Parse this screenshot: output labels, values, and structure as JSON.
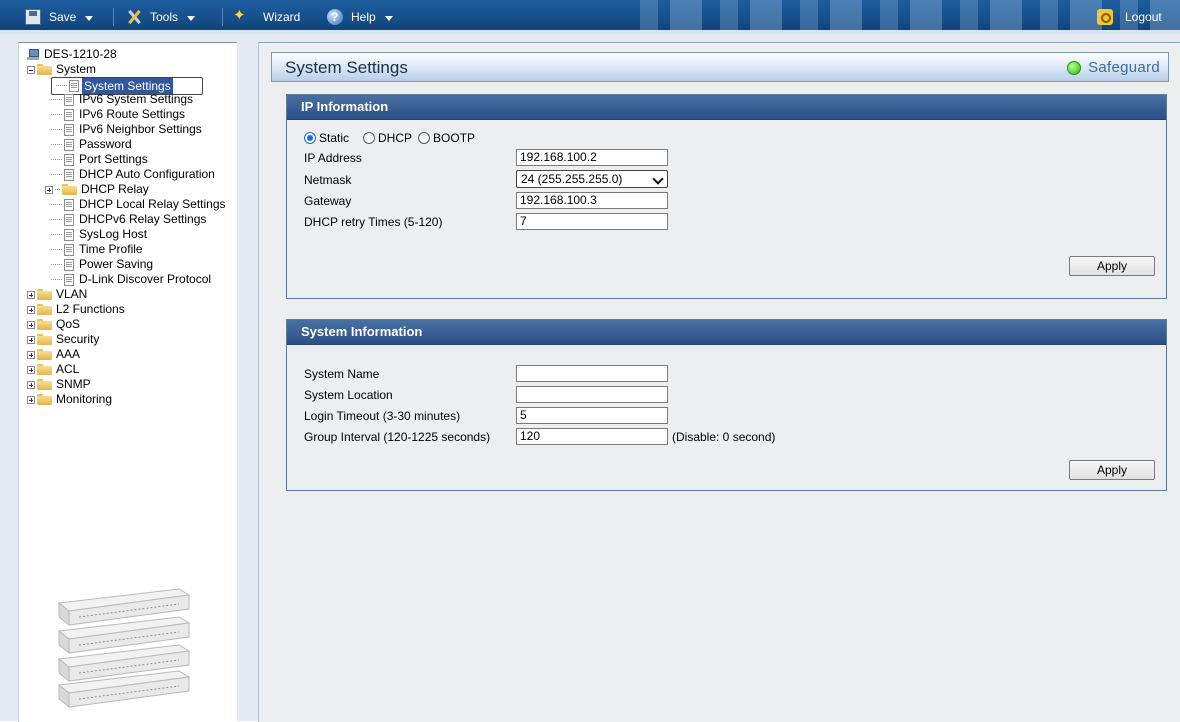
{
  "toolbar": {
    "save": "Save",
    "tools": "Tools",
    "wizard": "Wizard",
    "help": "Help",
    "logout": "Logout"
  },
  "tree": {
    "root": "DES-1210-28",
    "system": "System",
    "children": [
      "System Settings",
      "IPv6 System Settings",
      "IPv6 Route Settings",
      "IPv6 Neighbor Settings",
      "Password",
      "Port Settings",
      "DHCP Auto Configuration",
      "DHCP Relay",
      "DHCP Local Relay Settings",
      "DHCPv6 Relay Settings",
      "SysLog Host",
      "Time Profile",
      "Power Saving",
      "D-Link Discover Protocol"
    ],
    "groups": [
      "VLAN",
      "L2 Functions",
      "QoS",
      "Security",
      "AAA",
      "ACL",
      "SNMP",
      "Monitoring"
    ],
    "selected": "System Settings"
  },
  "page": {
    "title": "System Settings",
    "safeguard": "Safeguard",
    "safeguard_color": "#3cc41f"
  },
  "ip_info": {
    "header": "IP Information",
    "mode_options": [
      "Static",
      "DHCP",
      "BOOTP"
    ],
    "mode_selected": "Static",
    "ip_label": "IP Address",
    "ip_value": "192.168.100.2",
    "netmask_label": "Netmask",
    "netmask_value": "24 (255.255.255.0)",
    "gateway_label": "Gateway",
    "gateway_value": "192.168.100.3",
    "retry_label": "DHCP retry Times (5-120)",
    "retry_value": "7",
    "apply": "Apply"
  },
  "sys_info": {
    "header": "System Information",
    "name_label": "System Name",
    "name_value": "",
    "location_label": "System Location",
    "location_value": "",
    "timeout_label": "Login Timeout (3-30 minutes)",
    "timeout_value": "5",
    "group_label": "Group Interval (120-1225 seconds)",
    "group_value": "120",
    "group_note": "(Disable: 0 second)",
    "apply": "Apply"
  }
}
